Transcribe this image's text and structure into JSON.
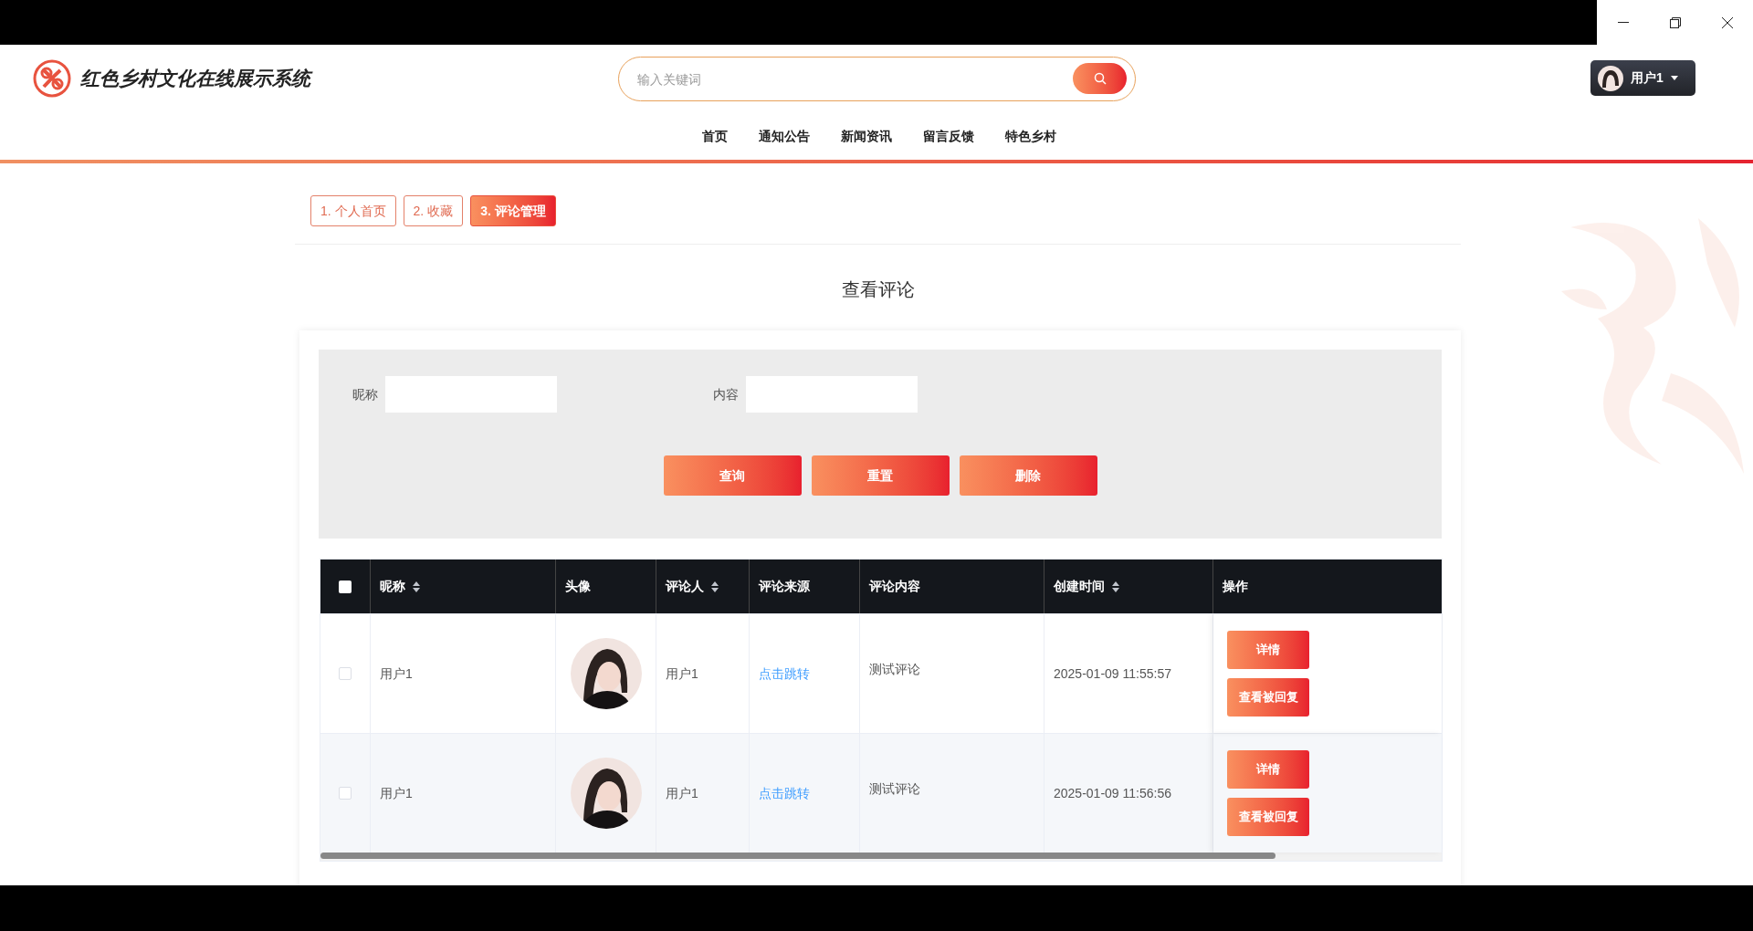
{
  "header": {
    "site_title": "红色乡村文化在线展示系统",
    "search": {
      "placeholder": "输入关键词"
    },
    "user": {
      "name": "用户1"
    }
  },
  "nav": [
    "首页",
    "通知公告",
    "新闻资讯",
    "留言反馈",
    "特色乡村"
  ],
  "tabs": [
    {
      "label": "1. 个人首页",
      "selected": false
    },
    {
      "label": "2. 收藏",
      "selected": false
    },
    {
      "label": "3. 评论管理",
      "selected": true
    }
  ],
  "page_title": "查看评论",
  "filters": [
    {
      "label": "昵称"
    },
    {
      "label": "内容"
    }
  ],
  "buttons": [
    "查询",
    "重置",
    "删除"
  ],
  "table": {
    "select_all": {
      "checked": false
    },
    "columns": [
      {
        "label": "昵称",
        "sortable": true
      },
      {
        "label": "头像",
        "sortable": false
      },
      {
        "label": "评论人",
        "sortable": true
      },
      {
        "label": "评论来源",
        "sortable": false
      },
      {
        "label": "评论内容",
        "sortable": false
      },
      {
        "label": "创建时间",
        "sortable": true
      },
      {
        "label": "操作",
        "sortable": false
      }
    ],
    "rows": [
      {
        "checked": false,
        "nickname": "用户1",
        "avatar": {
          "kind": "picture"
        },
        "commenter": "用户1",
        "source": "点击跳转",
        "content": "测试评论",
        "created": "2025-01-09 11:55:57",
        "actions": [
          "详情",
          "查看被回复"
        ]
      },
      {
        "checked": false,
        "nickname": "用户1",
        "avatar": {
          "kind": "picture"
        },
        "commenter": "用户1",
        "source": "点击跳转",
        "content": "测试评论",
        "created": "2025-01-09 11:56:56",
        "actions": [
          "详情",
          "查看被回复"
        ]
      }
    ]
  }
}
